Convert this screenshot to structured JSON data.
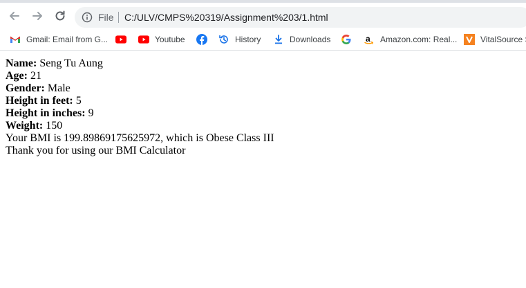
{
  "address_bar": {
    "scheme_label": "File",
    "url": "C:/ULV/CMPS%20319/Assignment%203/1.html"
  },
  "bookmarks": [
    {
      "label": "Gmail: Email from G...",
      "icon": "gmail-icon"
    },
    {
      "label": "",
      "icon": "youtube-icon"
    },
    {
      "label": "Youtube",
      "icon": "youtube-icon"
    },
    {
      "label": "",
      "icon": "facebook-icon"
    },
    {
      "label": "History",
      "icon": "history-icon"
    },
    {
      "label": "Downloads",
      "icon": "download-icon"
    },
    {
      "label": "",
      "icon": "google-icon"
    },
    {
      "label": "Amazon.com: Real...",
      "icon": "amazon-icon"
    },
    {
      "label": "VitalSource S",
      "icon": "vitalsource-icon"
    }
  ],
  "colors": {
    "youtube_red": "#ff0000",
    "facebook_blue": "#1877f2",
    "history_blue": "#1a73e8",
    "vitalsource_orange": "#f58220"
  },
  "page": {
    "name_label": "Name:",
    "name_value": "Seng Tu Aung",
    "age_label": "Age:",
    "age_value": "21",
    "gender_label": "Gender:",
    "gender_value": "Male",
    "height_feet_label": "Height in feet:",
    "height_feet_value": "5",
    "height_inches_label": "Height in inches:",
    "height_inches_value": "9",
    "weight_label": "Weight:",
    "weight_value": "150",
    "bmi_text": "Your BMI is 199.89869175625972, which is Obese Class III",
    "thanks_text": "Thank you for using our BMI Calculator"
  }
}
